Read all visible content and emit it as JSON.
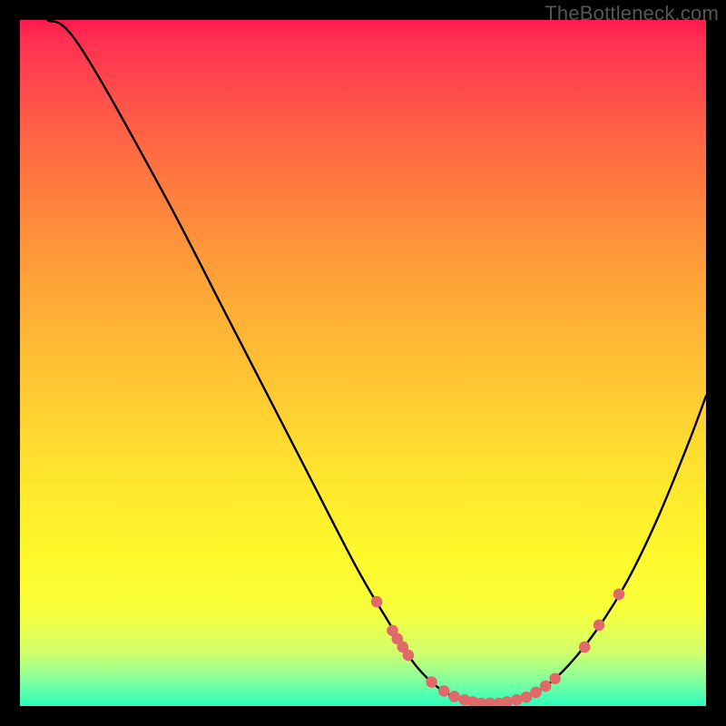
{
  "watermark": "TheBottleneck.com",
  "chart_data": {
    "type": "line",
    "title": "",
    "xlabel": "",
    "ylabel": "",
    "xlim": [
      0,
      1
    ],
    "ylim": [
      0,
      1
    ],
    "curve": [
      {
        "x": 0.04,
        "y": 1.0
      },
      {
        "x": 0.085,
        "y": 0.965
      },
      {
        "x": 0.205,
        "y": 0.755
      },
      {
        "x": 0.305,
        "y": 0.562
      },
      {
        "x": 0.41,
        "y": 0.358
      },
      {
        "x": 0.49,
        "y": 0.203
      },
      {
        "x": 0.54,
        "y": 0.118
      },
      {
        "x": 0.57,
        "y": 0.068
      },
      {
        "x": 0.602,
        "y": 0.033
      },
      {
        "x": 0.635,
        "y": 0.012
      },
      {
        "x": 0.668,
        "y": 0.004
      },
      {
        "x": 0.7,
        "y": 0.004
      },
      {
        "x": 0.73,
        "y": 0.01
      },
      {
        "x": 0.765,
        "y": 0.028
      },
      {
        "x": 0.8,
        "y": 0.06
      },
      {
        "x": 0.84,
        "y": 0.11
      },
      {
        "x": 0.885,
        "y": 0.182
      },
      {
        "x": 0.93,
        "y": 0.275
      },
      {
        "x": 0.975,
        "y": 0.385
      },
      {
        "x": 1.0,
        "y": 0.452
      }
    ],
    "dots": [
      {
        "x": 0.52,
        "y": 0.152
      },
      {
        "x": 0.543,
        "y": 0.11
      },
      {
        "x": 0.55,
        "y": 0.098
      },
      {
        "x": 0.558,
        "y": 0.086
      },
      {
        "x": 0.566,
        "y": 0.074
      },
      {
        "x": 0.6,
        "y": 0.035
      },
      {
        "x": 0.618,
        "y": 0.022
      },
      {
        "x": 0.633,
        "y": 0.014
      },
      {
        "x": 0.648,
        "y": 0.009
      },
      {
        "x": 0.66,
        "y": 0.006
      },
      {
        "x": 0.672,
        "y": 0.004
      },
      {
        "x": 0.685,
        "y": 0.004
      },
      {
        "x": 0.698,
        "y": 0.004
      },
      {
        "x": 0.71,
        "y": 0.006
      },
      {
        "x": 0.724,
        "y": 0.009
      },
      {
        "x": 0.738,
        "y": 0.013
      },
      {
        "x": 0.752,
        "y": 0.02
      },
      {
        "x": 0.766,
        "y": 0.029
      },
      {
        "x": 0.78,
        "y": 0.04
      },
      {
        "x": 0.823,
        "y": 0.086
      },
      {
        "x": 0.844,
        "y": 0.118
      },
      {
        "x": 0.873,
        "y": 0.163
      }
    ],
    "colors": {
      "curve": "#000000",
      "dots": "#e06a6a"
    }
  }
}
